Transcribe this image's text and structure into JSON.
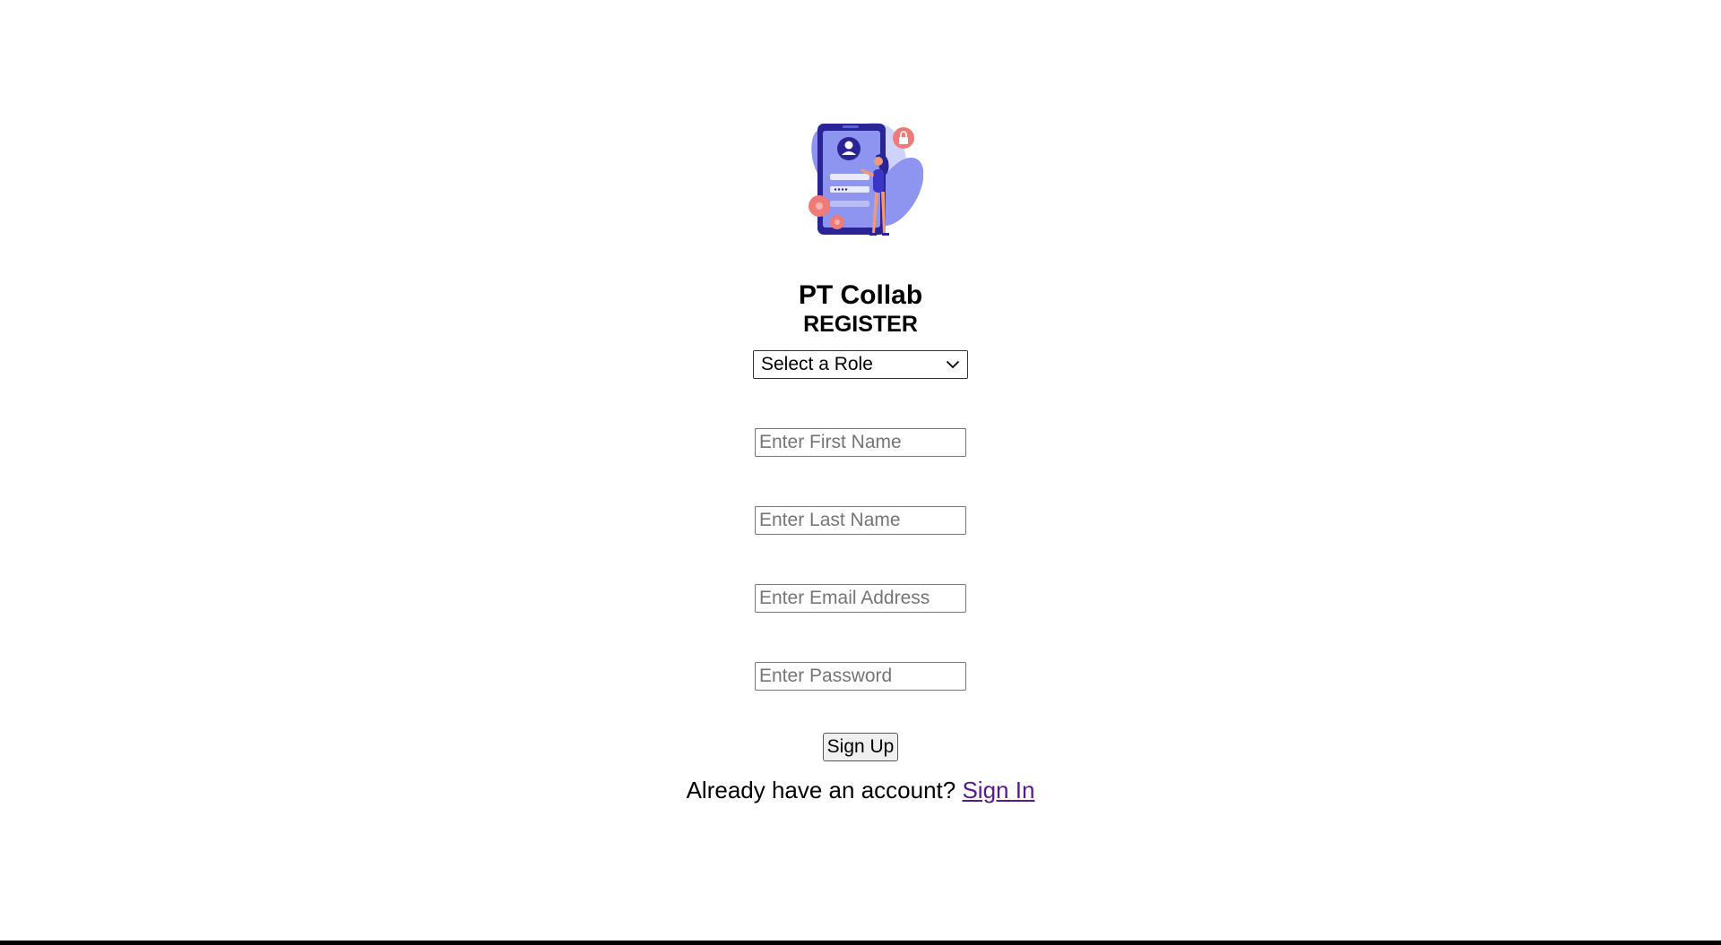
{
  "app": {
    "title": "PT Collab",
    "subtitle": "REGISTER"
  },
  "form": {
    "role_select": {
      "selected": "Select a Role"
    },
    "first_name": {
      "placeholder": "Enter First Name"
    },
    "last_name": {
      "placeholder": "Enter Last Name"
    },
    "email": {
      "placeholder": "Enter Email Address"
    },
    "password": {
      "placeholder": "Enter Password"
    },
    "submit_label": "Sign Up"
  },
  "footer": {
    "prompt": "Already have an account? ",
    "link_label": "Sign In"
  },
  "colors": {
    "illustration_primary": "#2a2496",
    "illustration_secondary": "#8d95f0",
    "illustration_light": "#cfd3fb",
    "illustration_accent": "#ee7b78",
    "link": "#551a8b"
  },
  "icons": {
    "illustration": "phone-login-illustration",
    "select_arrow": "chevron-down-icon"
  }
}
